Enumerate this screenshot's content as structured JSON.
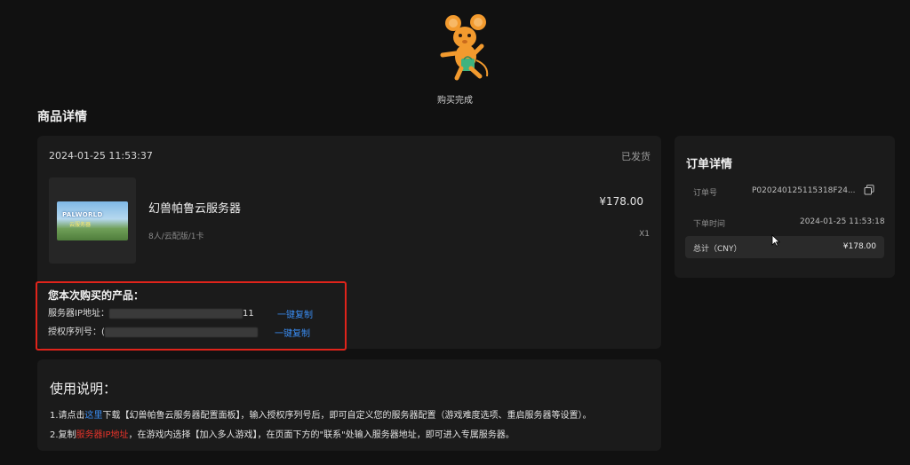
{
  "status": {
    "text": "购买完成"
  },
  "section_title": "商品详情",
  "order": {
    "time": "2024-01-25 11:53:37",
    "status": "已发货",
    "product": {
      "name": "幻兽帕鲁云服务器",
      "spec": "8人/云配版/1卡",
      "price": "¥178.00",
      "qty": "X1",
      "thumb_title": "PALWORLD",
      "thumb_sub": "云服务器"
    }
  },
  "purchased": {
    "title": "您本次购买的产品：",
    "ip_label": "服务器IP地址：",
    "ip_suffix": "11",
    "key_label": "授权序列号：",
    "key_prefix": "(",
    "copy_label": "一键复制"
  },
  "usage": {
    "title": "使用说明：",
    "line1_a": "1.请点击",
    "line1_link": "这里",
    "line1_b": "下载【幻兽帕鲁云服务器配置面板】，输入授权序列号后，即可自定义您的服务器配置（游戏难度选项、重启服务器等设置）。",
    "line2_a": "2.复制",
    "line2_red": "服务器IP地址",
    "line2_b": "，在游戏内选择【加入多人游戏】，在页面下方的\"联系\"处输入服务器地址，即可进入专属服务器。"
  },
  "order_detail": {
    "title": "订单详情",
    "order_no_label": "订单号",
    "order_no": "P020240125115318F24...",
    "order_time_label": "下单时间",
    "order_time": "2024-01-25 11:53:18",
    "total_label": "总计（CNY）",
    "total_value": "¥178.00"
  },
  "colors": {
    "background": "#111111",
    "card": "#1b1b1b",
    "link": "#3a8cf2",
    "highlight_border": "#e0241b",
    "red_text": "#e7332a",
    "mascot": "#f29a2e"
  },
  "icons": [
    "mascot-icon",
    "copy-icon",
    "cursor-icon"
  ]
}
